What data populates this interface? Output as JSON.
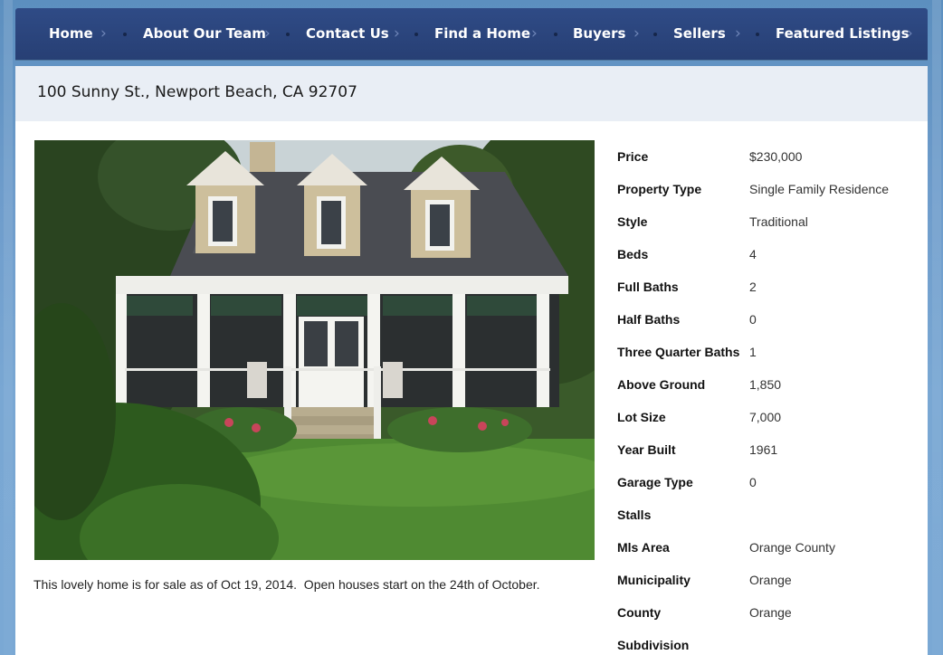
{
  "nav": {
    "items": [
      {
        "label": "Home"
      },
      {
        "label": "About Our Team"
      },
      {
        "label": "Contact Us"
      },
      {
        "label": "Find a Home"
      },
      {
        "label": "Buyers"
      },
      {
        "label": "Sellers"
      },
      {
        "label": "Featured Listings"
      }
    ]
  },
  "listing": {
    "title": "100 Sunny St., Newport Beach, CA 92707",
    "description": "This lovely home is for sale as of Oct 19, 2014.  Open houses start on the 24th of October.",
    "details": [
      {
        "label": "Price",
        "value": "$230,000"
      },
      {
        "label": "Property Type",
        "value": "Single Family Residence"
      },
      {
        "label": "Style",
        "value": "Traditional"
      },
      {
        "label": "Beds",
        "value": "4"
      },
      {
        "label": "Full Baths",
        "value": "2"
      },
      {
        "label": "Half Baths",
        "value": "0"
      },
      {
        "label": "Three Quarter Baths",
        "value": "1"
      },
      {
        "label": "Above Ground",
        "value": "1,850"
      },
      {
        "label": "Lot Size",
        "value": "7,000"
      },
      {
        "label": "Year Built",
        "value": "1961"
      },
      {
        "label": "Garage Type",
        "value": "0"
      },
      {
        "label": "Stalls",
        "value": ""
      },
      {
        "label": "Mls Area",
        "value": "Orange County"
      },
      {
        "label": "Municipality",
        "value": "Orange"
      },
      {
        "label": "County",
        "value": "Orange"
      },
      {
        "label": "Subdivision",
        "value": ""
      }
    ]
  },
  "colors": {
    "nav_background": "#2b4580",
    "title_bar": "#e9eef5",
    "page_background": "#6e9ccb"
  }
}
